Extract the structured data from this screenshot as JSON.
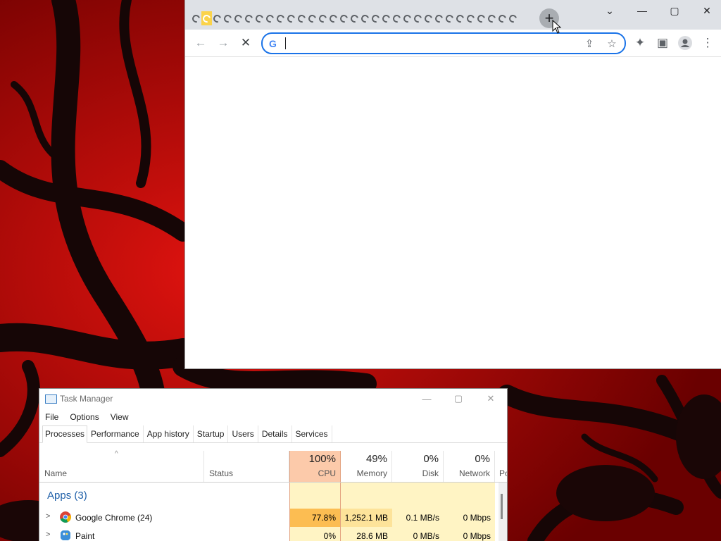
{
  "chrome": {
    "tab_count": 31,
    "active_tab_index": 1,
    "new_tab_label": "+",
    "icons": [
      "google-g-icon",
      "back-arrow-icon",
      "forward-arrow-icon",
      "stop-loading-icon",
      "share-icon",
      "star-icon",
      "extensions-puzzle-icon",
      "side-panel-icon",
      "profile-icon",
      "kebab-menu-icon",
      "tab-search-chevron-icon",
      "minimize-icon",
      "maximize-icon",
      "close-icon"
    ],
    "omnibox": {
      "value": "",
      "placeholder": ""
    },
    "omnibox_focus_color": "#1a73e8"
  },
  "task_manager": {
    "title": "Task Manager",
    "menu": [
      "File",
      "Options",
      "View"
    ],
    "tabs": [
      "Processes",
      "Performance",
      "App history",
      "Startup",
      "Users",
      "Details",
      "Services"
    ],
    "active_tab": "Processes",
    "columns": {
      "name": {
        "label": "Name"
      },
      "status": {
        "label": "Status"
      },
      "cpu": {
        "pct": "100%",
        "label": "CPU"
      },
      "memory": {
        "pct": "49%",
        "label": "Memory"
      },
      "disk": {
        "pct": "0%",
        "label": "Disk"
      },
      "network": {
        "pct": "0%",
        "label": "Network"
      },
      "power": {
        "label": "Po"
      }
    },
    "group": {
      "title": "Apps (3)"
    },
    "rows": [
      {
        "name": "Google Chrome (24)",
        "status": "",
        "cpu": "77.8%",
        "memory": "1,252.1 MB",
        "disk": "0.1 MB/s",
        "network": "0 Mbps",
        "icon": "chrome-icon"
      },
      {
        "name": "Paint",
        "status": "",
        "cpu": "0%",
        "memory": "28.6 MB",
        "disk": "0 MB/s",
        "network": "0 Mbps",
        "icon": "paint-icon"
      }
    ],
    "colors": {
      "cpu_header": "#fccaaa",
      "cpu_hot": "#fcbd52",
      "heat_light": "#fff4c4",
      "heat_mid": "#fde39a"
    }
  }
}
